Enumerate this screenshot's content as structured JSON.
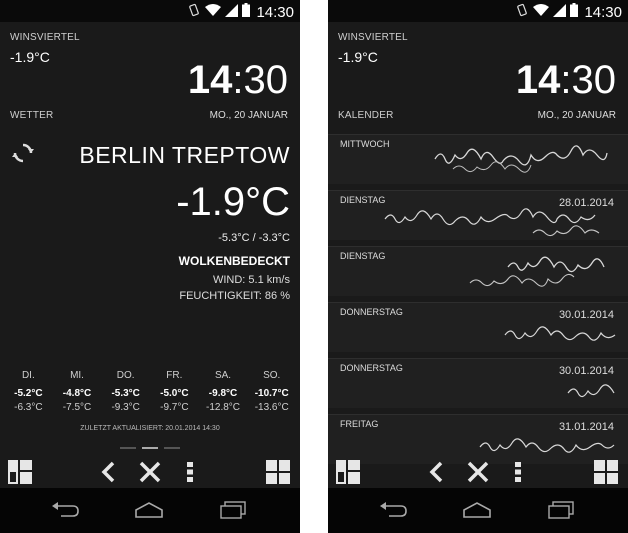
{
  "status": {
    "time": "14:30"
  },
  "common": {
    "location_label": "WINSVIERTEL",
    "temp_small": "-1.9°C",
    "clock_hours": "14",
    "clock_minutes": "30",
    "date": "MO., 20 JANUAR"
  },
  "left": {
    "section_label": "WETTER",
    "city": "BERLIN TREPTOW",
    "temperature": "-1.9°C",
    "minmax": "-5.3°C / -3.3°C",
    "condition": "WOLKENBEDECKT",
    "wind": "WIND: 5.1 km/s",
    "humidity": "FEUCHTIGKEIT: 86 %",
    "forecast": [
      {
        "day": "DI.",
        "high": "-5.2°C",
        "low": "-6.3°C"
      },
      {
        "day": "MI.",
        "high": "-4.8°C",
        "low": "-7.5°C"
      },
      {
        "day": "DO.",
        "high": "-5.3°C",
        "low": "-9.3°C"
      },
      {
        "day": "FR.",
        "high": "-5.0°C",
        "low": "-9.7°C"
      },
      {
        "day": "SA.",
        "high": "-9.8°C",
        "low": "-12.8°C"
      },
      {
        "day": "SO.",
        "high": "-10.7°C",
        "low": "-13.6°C"
      }
    ],
    "updated": "ZULETZT AKTUALISIERT: 20.01.2014 14:30"
  },
  "right": {
    "section_label": "KALENDER",
    "events": [
      {
        "day": "MITTWOCH",
        "date": ""
      },
      {
        "day": "DIENSTAG",
        "date": "28.01.2014"
      },
      {
        "day": "DIENSTAG",
        "date": ""
      },
      {
        "day": "DONNERSTAG",
        "date": "30.01.2014"
      },
      {
        "day": "DONNERSTAG",
        "date": "30.01.2014"
      },
      {
        "day": "FREITAG",
        "date": "31.01.2014"
      }
    ]
  },
  "icons": {
    "refresh": "refresh-icon",
    "layout": "layout-icon",
    "back": "chevron-left-icon",
    "close": "close-icon",
    "menu": "overflow-menu-icon",
    "grid": "grid-icon",
    "nav_back": "nav-back-icon",
    "nav_home": "nav-home-icon",
    "nav_recents": "nav-recents-icon"
  },
  "colors": {
    "background": "#141414",
    "text": "#ffffff",
    "muted": "#cfcfcf"
  }
}
